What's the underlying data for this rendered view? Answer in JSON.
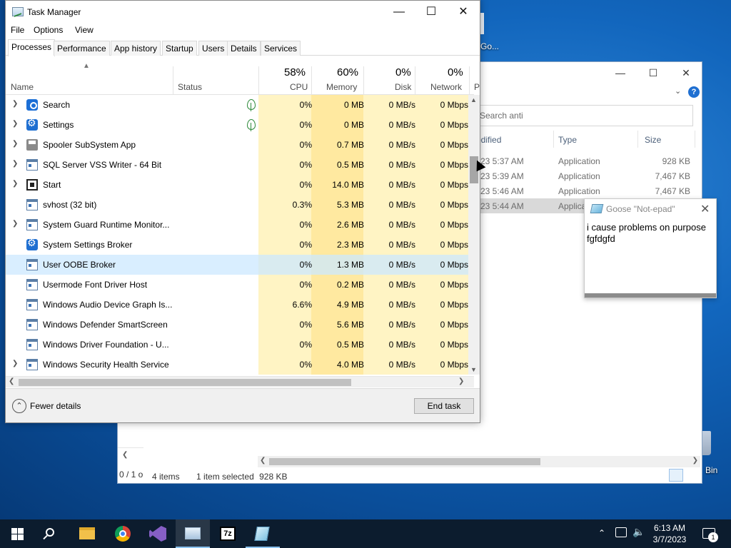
{
  "desktop": {
    "icon_partial_label": "Go...",
    "recycle_partial_label": "Bin"
  },
  "explorer": {
    "search_placeholder": "Search anti",
    "columns": {
      "modified": "odified",
      "type": "Type",
      "size": "Size"
    },
    "rows": [
      {
        "modified": "23 5:37 AM",
        "type": "Application",
        "size": "928 KB"
      },
      {
        "modified": "23 5:39 AM",
        "type": "Application",
        "size": "7,467 KB"
      },
      {
        "modified": "23 5:46 AM",
        "type": "Application",
        "size": "7,467 KB"
      },
      {
        "modified": "23 5:44 AM",
        "type": "Applica",
        "size": ""
      }
    ],
    "left_status": "0 / 1 o",
    "status_items": "4 items",
    "status_selected": "1 item selected",
    "status_size": "928 KB"
  },
  "goose": {
    "title": "Goose \"Not-epad\"",
    "text": "i cause problems on purpose\nfgfdgfd"
  },
  "task_manager": {
    "title": "Task Manager",
    "menu": [
      "File",
      "Options",
      "View"
    ],
    "tabs": [
      "Processes",
      "Performance",
      "App history",
      "Startup",
      "Users",
      "Details",
      "Services"
    ],
    "active_tab": "Processes",
    "columns": {
      "name": "Name",
      "status": "Status",
      "cpu_pct": "58%",
      "cpu": "CPU",
      "mem_pct": "60%",
      "mem": "Memory",
      "disk_pct": "0%",
      "disk": "Disk",
      "net_pct": "0%",
      "net": "Network",
      "extra": "P"
    },
    "processes": [
      {
        "name": "Search",
        "icon": "search-icon",
        "expand": true,
        "eco": true,
        "cpu": "0%",
        "mem": "0 MB",
        "disk": "0 MB/s",
        "net": "0 Mbps"
      },
      {
        "name": "Settings",
        "icon": "gear-icon",
        "expand": true,
        "eco": true,
        "cpu": "0%",
        "mem": "0 MB",
        "disk": "0 MB/s",
        "net": "0 Mbps"
      },
      {
        "name": "Spooler SubSystem App",
        "icon": "printer-icon",
        "expand": true,
        "eco": false,
        "cpu": "0%",
        "mem": "0.7 MB",
        "disk": "0 MB/s",
        "net": "0 Mbps"
      },
      {
        "name": "SQL Server VSS Writer - 64 Bit",
        "icon": "app-window-icon",
        "expand": true,
        "eco": false,
        "cpu": "0%",
        "mem": "0.5 MB",
        "disk": "0 MB/s",
        "net": "0 Mbps"
      },
      {
        "name": "Start",
        "icon": "start-icon",
        "expand": true,
        "eco": false,
        "cpu": "0%",
        "mem": "14.0 MB",
        "disk": "0 MB/s",
        "net": "0 Mbps"
      },
      {
        "name": "svhost (32 bit)",
        "icon": "app-window-icon",
        "expand": false,
        "eco": false,
        "cpu": "0.3%",
        "mem": "5.3 MB",
        "disk": "0 MB/s",
        "net": "0 Mbps"
      },
      {
        "name": "System Guard Runtime Monitor...",
        "icon": "app-window-icon",
        "expand": true,
        "eco": false,
        "cpu": "0%",
        "mem": "2.6 MB",
        "disk": "0 MB/s",
        "net": "0 Mbps"
      },
      {
        "name": "System Settings Broker",
        "icon": "gear-icon",
        "expand": false,
        "eco": false,
        "cpu": "0%",
        "mem": "2.3 MB",
        "disk": "0 MB/s",
        "net": "0 Mbps"
      },
      {
        "name": "User OOBE Broker",
        "icon": "app-window-icon",
        "expand": false,
        "eco": false,
        "cpu": "0%",
        "mem": "1.3 MB",
        "disk": "0 MB/s",
        "net": "0 Mbps",
        "selected": true
      },
      {
        "name": "Usermode Font Driver Host",
        "icon": "app-window-icon",
        "expand": false,
        "eco": false,
        "cpu": "0%",
        "mem": "0.2 MB",
        "disk": "0 MB/s",
        "net": "0 Mbps"
      },
      {
        "name": "Windows Audio Device Graph Is...",
        "icon": "app-window-icon",
        "expand": false,
        "eco": false,
        "cpu": "6.6%",
        "mem": "4.9 MB",
        "disk": "0 MB/s",
        "net": "0 Mbps"
      },
      {
        "name": "Windows Defender SmartScreen",
        "icon": "app-window-icon",
        "expand": false,
        "eco": false,
        "cpu": "0%",
        "mem": "5.6 MB",
        "disk": "0 MB/s",
        "net": "0 Mbps"
      },
      {
        "name": "Windows Driver Foundation - U...",
        "icon": "app-window-icon",
        "expand": false,
        "eco": false,
        "cpu": "0%",
        "mem": "0.5 MB",
        "disk": "0 MB/s",
        "net": "0 Mbps"
      },
      {
        "name": "Windows Security Health Service",
        "icon": "app-window-icon",
        "expand": true,
        "eco": false,
        "cpu": "0%",
        "mem": "4.0 MB",
        "disk": "0 MB/s",
        "net": "0 Mbps"
      }
    ],
    "fewer_details": "Fewer details",
    "end_task": "End task",
    "heat_colors": {
      "light": "#fff4c4",
      "mid": "#ffe9a0",
      "sel": "#cce8ff"
    }
  },
  "taskbar": {
    "time": "6:13 AM",
    "date": "3/7/2023",
    "notification_count": "1"
  }
}
